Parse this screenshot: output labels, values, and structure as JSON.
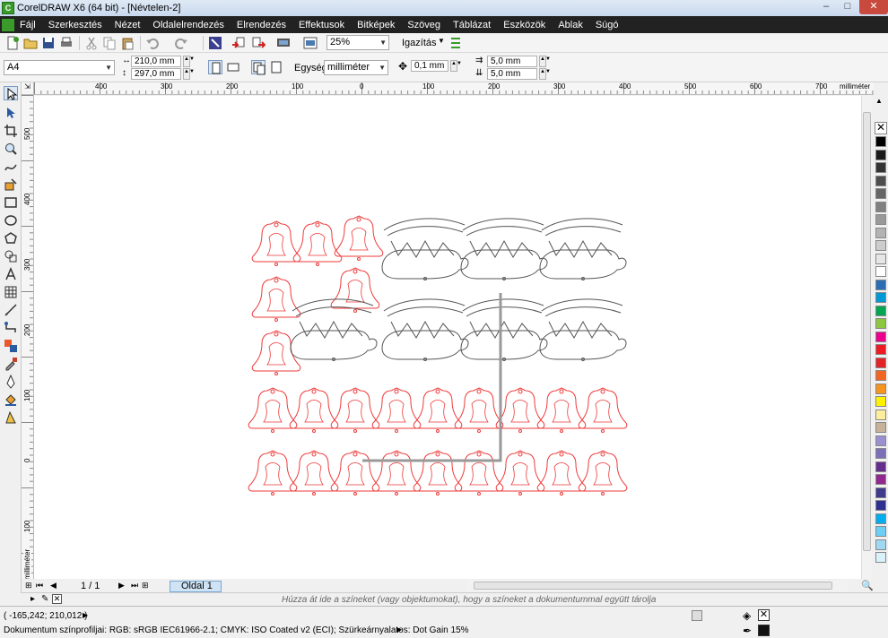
{
  "window": {
    "title": "CorelDRAW X6 (64 bit) - [Névtelen-2]",
    "min": "–",
    "max": "□",
    "close": "✕"
  },
  "menu": [
    "Fájl",
    "Szerkesztés",
    "Nézet",
    "Oldalelrendezés",
    "Elrendezés",
    "Effektusok",
    "Bitképek",
    "Szöveg",
    "Táblázat",
    "Eszközök",
    "Ablak",
    "Súgó"
  ],
  "toolbar": {
    "zoom": "25%",
    "snap_label": "Igazítás"
  },
  "property_bar": {
    "paper_size": "A4",
    "width": "210,0 mm",
    "height": "297,0 mm",
    "unit_label": "Egység:",
    "unit_value": "milliméter",
    "nudge": "0,1 mm",
    "dup_x": "5,0 mm",
    "dup_y": "5,0 mm"
  },
  "ruler": {
    "unit": "milliméter",
    "top_labels": [
      "400",
      "300",
      "200",
      "100",
      "0",
      "100",
      "200",
      "300",
      "400",
      "500",
      "600",
      "700"
    ],
    "left_labels": [
      "500",
      "400",
      "300",
      "200",
      "100",
      "0",
      "100"
    ],
    "left_unit": "milliméter"
  },
  "page_nav": {
    "counter": "1 / 1",
    "tab": "Oldal 1"
  },
  "hint": "Húzza át ide a színeket (vagy objektumokat), hogy a színeket a dokumentummal együtt tárolja",
  "status": {
    "coords": "( -165,242; 210,012 )",
    "color_profile": "Dokumentum színprofiljai: RGB: sRGB IEC61966-2.1; CMYK: ISO Coated v2 (ECI); Szürkeárnyalatos: Dot Gain 15%"
  },
  "palette": [
    "#000000",
    "#1a1a1a",
    "#333333",
    "#4d4d4d",
    "#666666",
    "#808080",
    "#999999",
    "#b3b3b3",
    "#cccccc",
    "#e6e6e6",
    "#ffffff",
    "#2a6db5",
    "#0099d6",
    "#00a651",
    "#8dc63f",
    "#ec008c",
    "#ed1c24",
    "#e32427",
    "#f26522",
    "#f7941d",
    "#fff200",
    "#fcee9c",
    "#c7b299",
    "#9b8fcf",
    "#7b6fb8",
    "#662d91",
    "#92278f",
    "#3f3a8c",
    "#2e3192",
    "#00aeef",
    "#6dcff6",
    "#a0d7f2",
    "#d9f1fb"
  ]
}
